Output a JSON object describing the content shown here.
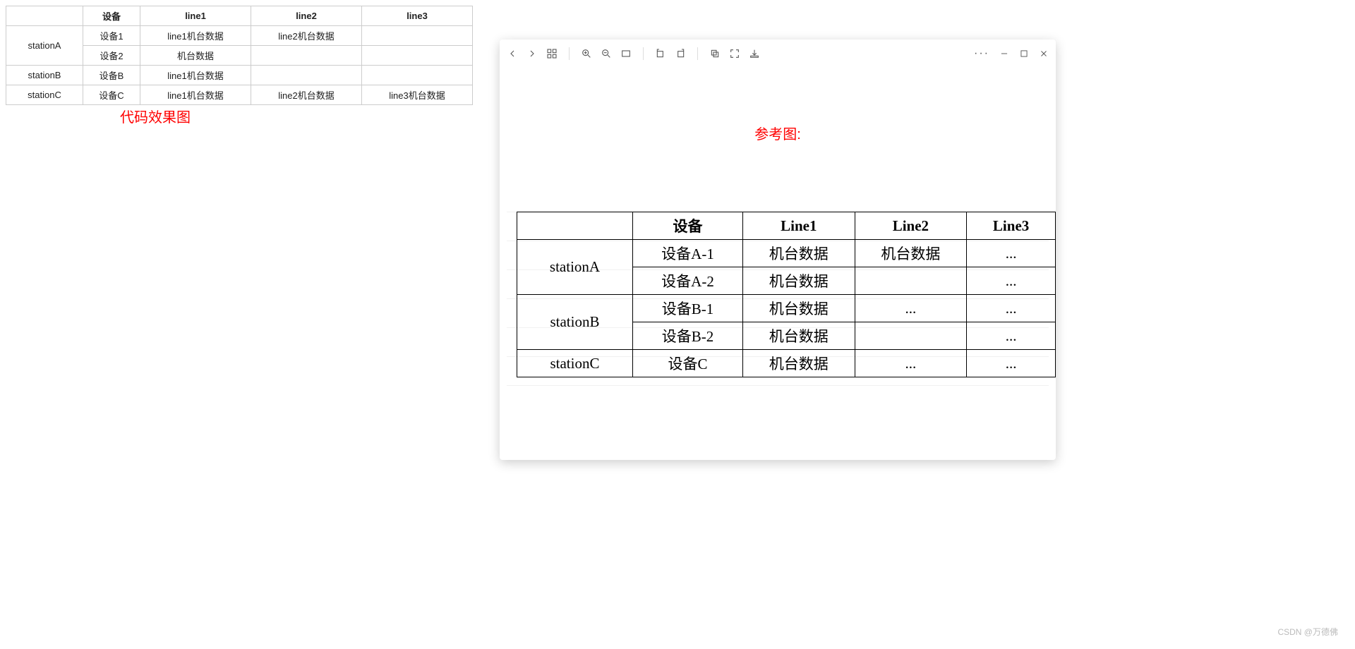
{
  "leftTable": {
    "headers": [
      "",
      "设备",
      "line1",
      "line2",
      "line3"
    ],
    "groups": [
      {
        "station": "stationA",
        "rows": [
          {
            "dev": "设备1",
            "l1": "line1机台数据",
            "l2": "line2机台数据",
            "l3": ""
          },
          {
            "dev": "设备2",
            "l1": "机台数据",
            "l2": "",
            "l3": ""
          }
        ]
      },
      {
        "station": "stationB",
        "rows": [
          {
            "dev": "设备B",
            "l1": "line1机台数据",
            "l2": "",
            "l3": ""
          }
        ]
      },
      {
        "station": "stationC",
        "rows": [
          {
            "dev": "设备C",
            "l1": "line1机台数据",
            "l2": "line2机台数据",
            "l3": "line3机台数据"
          }
        ]
      }
    ]
  },
  "captions": {
    "left": "代码效果图",
    "right": "参考图:"
  },
  "refTable": {
    "headers": [
      "",
      "设备",
      "Line1",
      "Line2",
      "Line3"
    ],
    "groups": [
      {
        "station": "stationA",
        "rows": [
          {
            "dev": "设备A-1",
            "l1": "机台数据",
            "l2": "机台数据",
            "l3": "..."
          },
          {
            "dev": "设备A-2",
            "l1": "机台数据",
            "l2": "",
            "l3": "..."
          }
        ]
      },
      {
        "station": "stationB",
        "rows": [
          {
            "dev": "设备B-1",
            "l1": "机台数据",
            "l2": "...",
            "l3": "..."
          },
          {
            "dev": "设备B-2",
            "l1": "机台数据",
            "l2": "",
            "l3": "..."
          }
        ]
      },
      {
        "station": "stationC",
        "rows": [
          {
            "dev": "设备C",
            "l1": "机台数据",
            "l2": "...",
            "l3": "..."
          }
        ]
      }
    ]
  },
  "watermark": "CSDN @万德佛"
}
